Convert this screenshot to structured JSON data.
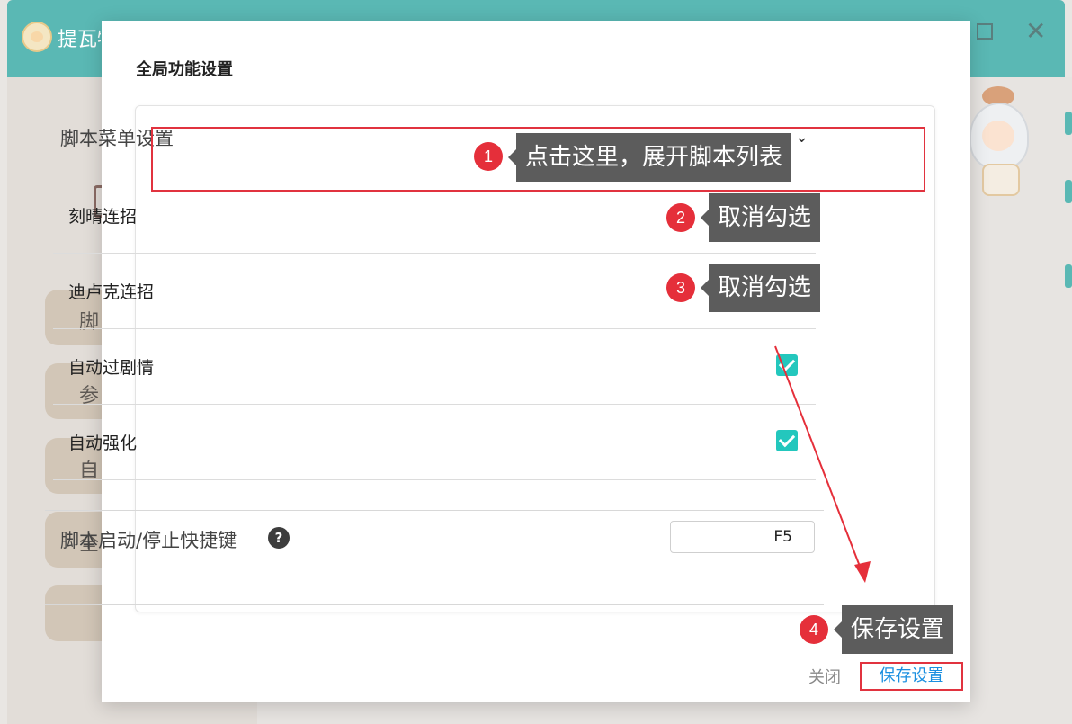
{
  "app": {
    "title": "提瓦特"
  },
  "sidebar": {
    "items": [
      "脚",
      "参",
      "自",
      "全",
      ""
    ]
  },
  "modal": {
    "title": "全局功能设置",
    "section": {
      "label": "脚本菜单设置",
      "expanded": true
    },
    "options": [
      {
        "label": "刻晴连招",
        "checked": false
      },
      {
        "label": "迪卢克连招",
        "checked": false
      },
      {
        "label": "自动过剧情",
        "checked": true
      },
      {
        "label": "自动强化",
        "checked": true
      }
    ],
    "hotkey": {
      "label": "脚本启动/停止快捷键",
      "help_icon": "?",
      "value": "F5"
    },
    "footer": {
      "close_label": "关闭",
      "save_label": "保存设置"
    }
  },
  "annotations": [
    {
      "number": "1",
      "text": "点击这里，展开脚本列表"
    },
    {
      "number": "2",
      "text": "取消勾选"
    },
    {
      "number": "3",
      "text": "取消勾选"
    },
    {
      "number": "4",
      "text": "保存设置"
    }
  ],
  "colors": {
    "titlebar": "#5ab8b4",
    "accent_check": "#23c7bd",
    "annotation_red": "#e52f3a",
    "link_blue": "#1a8fe0",
    "callout_bg": "#5c5c5c"
  }
}
